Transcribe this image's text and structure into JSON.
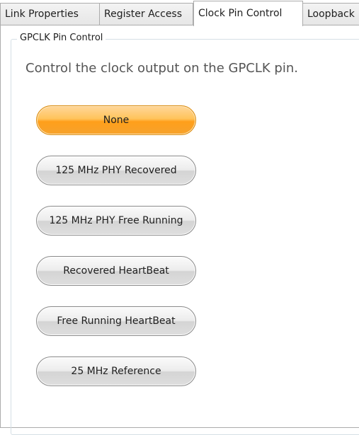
{
  "tabs": [
    {
      "label": "Link Properties",
      "selected": false
    },
    {
      "label": "Register Access",
      "selected": false
    },
    {
      "label": "Clock Pin Control",
      "selected": true
    },
    {
      "label": "Loopback",
      "selected": false
    }
  ],
  "group": {
    "title": "GPCLK Pin Control",
    "description": "Control the clock output on the GPCLK pin."
  },
  "options": [
    {
      "label": "None",
      "selected": true
    },
    {
      "label": "125 MHz PHY Recovered",
      "selected": false
    },
    {
      "label": "125 MHz PHY Free Running",
      "selected": false
    },
    {
      "label": "Recovered HeartBeat",
      "selected": false
    },
    {
      "label": "Free Running HeartBeat",
      "selected": false
    },
    {
      "label": "25 MHz Reference",
      "selected": false
    }
  ],
  "colors": {
    "selected_button": "#ff9f1a",
    "button_border": "#8a8a8a",
    "description_text": "#555555"
  }
}
